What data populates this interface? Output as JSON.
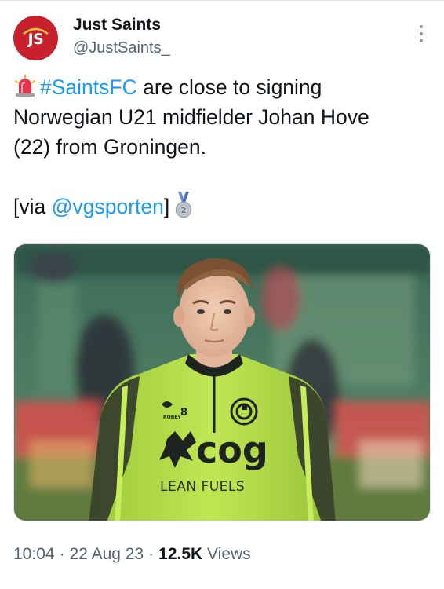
{
  "author": {
    "display_name": "Just Saints",
    "handle": "@JustSaints_",
    "avatar_text": "JS",
    "avatar_color": "#c8202c"
  },
  "tweet": {
    "hashtag": "#SaintsFC",
    "text_part1": " are close to signing\nNorwegian U21 midfielder Johan Hove\n(22) from Groningen.\n\n[via ",
    "mention": "@vgsporten",
    "text_part2": "]",
    "emoji_lead": "rotating-light-icon",
    "emoji_trail": "second-place-medal-icon"
  },
  "media": {
    "shirt_number": "8",
    "sponsor_text": "LEAN FUELS",
    "sponsor_logo": "cog"
  },
  "meta": {
    "time": "10:04",
    "date": "22 Aug 23",
    "views_count": "12.5K",
    "views_label": " Views",
    "separator": "·"
  },
  "colors": {
    "link": "#1d9bf0",
    "secondary_text": "#536471",
    "primary_text": "#0f1419",
    "jersey": "#b7e04a"
  }
}
